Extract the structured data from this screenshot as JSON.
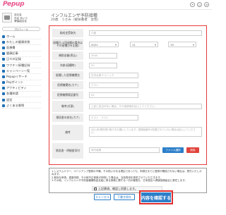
{
  "header": {
    "logo": "Pepup",
    "icons": [
      "bell-icon",
      "user-icon",
      "menu-icon"
    ]
  },
  "sidebar": {
    "profile_lines": [
      "自社名",
      "氏名 あいう",
      "健保組合名"
    ],
    "profile_button": "プロフィール",
    "items": [
      {
        "label": "ホーム",
        "icon": "home-icon"
      },
      {
        "label": "わたしの健康状態",
        "icon": "heart-icon"
      },
      {
        "label": "医療費",
        "icon": "yen-icon"
      },
      {
        "label": "健康記事",
        "icon": "article-icon"
      },
      {
        "label": "日々の記録",
        "icon": "calendar-icon"
      },
      {
        "label": "ワクチン接種記録",
        "icon": "vaccine-icon"
      },
      {
        "label": "キャンペーン一覧",
        "icon": "campaign-icon"
      },
      {
        "label": "Pepupリサーチ",
        "icon": "research-icon"
      },
      {
        "label": "Pepポイント",
        "icon": "point-icon"
      },
      {
        "label": "アクティビティ",
        "icon": "activity-icon"
      },
      {
        "label": "各種申請",
        "icon": "document-icon"
      },
      {
        "label": "設定",
        "icon": "gear-icon"
      },
      {
        "label": "よくある質問",
        "icon": "question-icon"
      }
    ]
  },
  "main": {
    "title": "インフルエンザ予防接種",
    "subtitle": "20歳　うさみ（被扶養者　女性）",
    "form": {
      "recipient": {
        "label": "助成金受取先",
        "placeholder": "口座"
      },
      "vaccination_date": {
        "label": "接種日(1回接種の場合はその接種日を記載)",
        "year": "2021",
        "month": "11",
        "day": "19"
      },
      "amount": {
        "label": "補助金額(税込)",
        "placeholder": "3000"
      },
      "age": {
        "label": "年齢(接種時)",
        "placeholder": "20"
      },
      "clinic_name": {
        "label": "接種した医療機関名",
        "placeholder": "日本太郎クリニック"
      },
      "clinic_kana": {
        "label": "医療機関名(カナ)",
        "placeholder": "テスト"
      },
      "phone": {
        "label": "医療機関電話番号",
        "placeholder": "03"
      },
      "notes": {
        "label": "備考(任意)",
        "placeholder": "上記に該当がない場合、その他詳細を記入してください。"
      },
      "receipt_kana": {
        "label": "領収書の宛名(カナ)",
        "placeholder": "テスト　テスト"
      },
      "remarks": {
        "label": "備考",
        "placeholder": "(記入例)現在受け取りをお願いしています。保険者番号が記載されていない場合は記入してください。"
      },
      "attachment": {
        "label": "領収書・明細書添付",
        "filename": "添付画像",
        "select_label": "ファイル選択",
        "delete_label": "削除"
      }
    },
    "notice_lines": [
      "1.システムエラー、ページアップ登録の不備、その他いかなる理由であっても、申請日までに登録が確認されない場合は、受付いたしかねます。",
      "2.無効な申請、重複申請、その他不正事実が判明した場合は、当該費用を請求させていただきます。",
      "3.その他、インフルエンザ予防接種補助金支給に係る事務に関する一切の権限を、日本国法人健康保険組合に委任します。"
    ],
    "agree_label": "上記事項、確認し同意します。",
    "cancel_label": "キャンセル",
    "draft_label": "下書き保存",
    "confirm_label": "内容を確認する"
  }
}
